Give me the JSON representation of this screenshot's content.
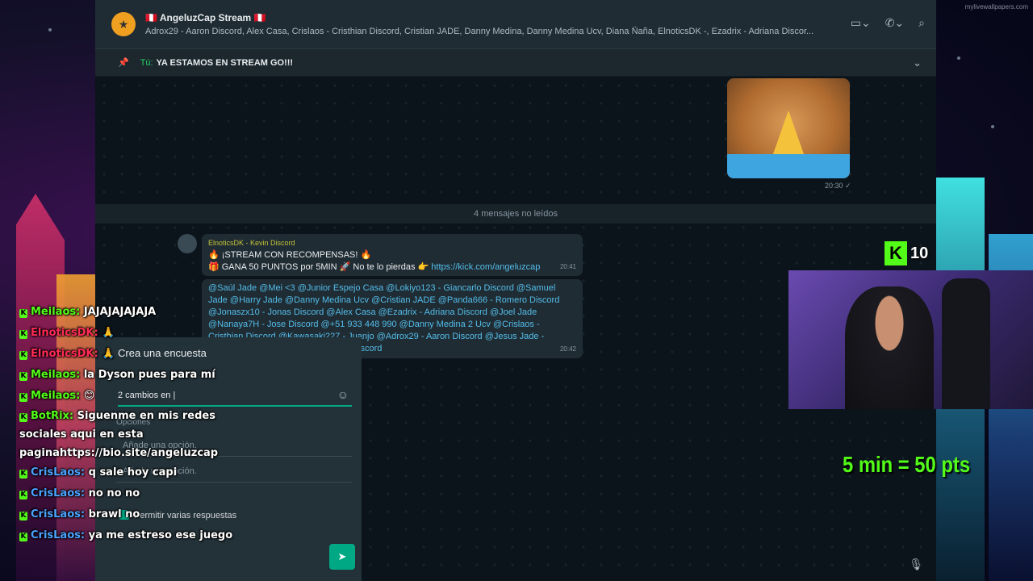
{
  "group": {
    "title": "🇵🇪 AngeluzCap Stream 🇵🇪",
    "members": "Adrox29 - Aaron Discord, Alex Casa, Crislaos - Cristhian Discord, Cristian JADE, Danny Medina, Danny Medina Ucv, Diana Ñaña, ElnoticsDK -, Ezadrix - Adriana Discor..."
  },
  "pinned": {
    "who": "Tú:",
    "text": "YA ESTAMOS EN STREAM GO!!!"
  },
  "sticker_time": "20:30 ✓",
  "unread_label": "4 mensajes no leídos",
  "messages": [
    {
      "sender": "ElnoticsDK - Kevin Discord",
      "line1": "🔥 ¡STREAM CON RECOMPENSAS! 🔥",
      "line2": "🎁 GANA 50 PUNTOS por 5MIN 🚀 No te lo pierdas 👉 ",
      "link": "https://kick.com/angeluzcap",
      "time": "20:41"
    },
    {
      "text": "@Saúl Jade @Mei <3 @Junior Espejo Casa @Lokiyo123 - Giancarlo Discord @Samuel Jade @Harry Jade @Danny Medina Ucv @Cristian JADE @Panda666 - Romero Discord @Jonaszx10 - Jonas Discord @Alex Casa @Ezadrix - Adriana Discord @Joel Jade @Nanaya7H - Jose Discord @+51 933 448 990 @Danny Medina 2 Ucv @Crislaos - Cristhian Discord @Kawasaki227 - Juanjo @Adrox29 - Aaron Discord @Jesus Jade - Jesus Discord @Robyn_27 - Robyn Discord",
      "time": "20:42"
    }
  ],
  "poll": {
    "title": "Crea una encuesta",
    "question": "2 cambios en |",
    "options_label": "Opciones",
    "option_placeholder_1": "Añade una opción.",
    "option_placeholder_2": "Añade una opción.",
    "multi": "Permitir varias respuestas"
  },
  "stream_chat": [
    {
      "user": "Meilaos:",
      "msg": "JAJAJAJAJAJA",
      "color": "green"
    },
    {
      "user": "ElnoticsDK:",
      "msg": "🙏",
      "color": "red"
    },
    {
      "user": "ElnoticsDK:",
      "msg": "🙏",
      "color": "red"
    },
    {
      "user": "Meilaos:",
      "msg": "la Dyson pues para mí",
      "color": "green"
    },
    {
      "user": "Meilaos:",
      "msg": "😊",
      "color": "green"
    },
    {
      "user": "BotRix:",
      "msg": "Siguenme en mis redes sociales aqui en esta paginahttps://bio.site/angeluzcap",
      "color": "green",
      "wrap": true
    },
    {
      "user": "CrisLaos:",
      "msg": "q sale hoy capi",
      "color": "blue"
    },
    {
      "user": "CrisLaos:",
      "msg": "no no no",
      "color": "blue"
    },
    {
      "user": "CrisLaos:",
      "msg": "brawl no",
      "color": "blue"
    },
    {
      "user": "CrisLaos:",
      "msg": "ya me estreso ese juego",
      "color": "blue"
    }
  ],
  "kick": {
    "logo": "K",
    "viewers": "10"
  },
  "promo": "5 min = 50 pts",
  "watermark": "mylivewallpapers.com"
}
